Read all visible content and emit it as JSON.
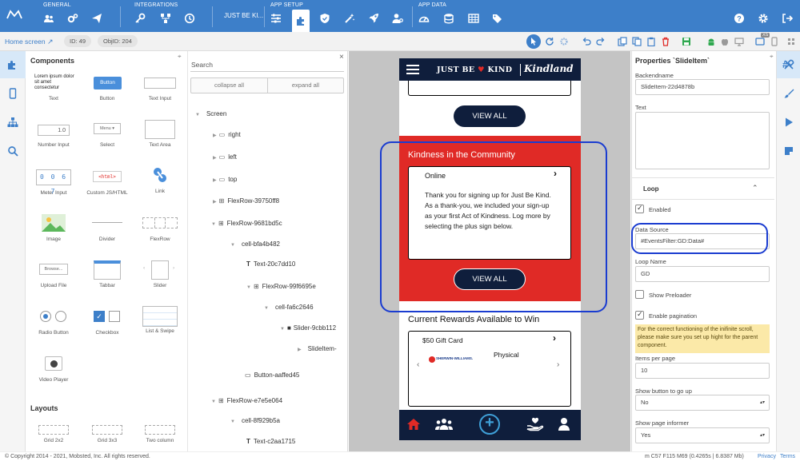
{
  "topbar": {
    "sections": {
      "general": "GENERAL",
      "integrations": "INTEGRATIONS",
      "app_setup": "APP SETUP",
      "app_data": "APP DATA"
    },
    "app_name": "JUST BE KI...",
    "colors": {
      "bar": "#3d7fc9",
      "accent": "#1a3cd0"
    }
  },
  "subbar": {
    "home_label": "Home screen",
    "id_label": "ID:",
    "id_value": "49",
    "objid_label": "ObjID:",
    "objid_value": "204",
    "badge": "XS"
  },
  "components": {
    "title": "Components",
    "items": [
      {
        "label": "Text",
        "preview": "Lorem ipsum dolor sit amet consectetur"
      },
      {
        "label": "Button",
        "preview": "Button"
      },
      {
        "label": "Text Input"
      },
      {
        "label": "Number Input",
        "preview": "1.0"
      },
      {
        "label": "Select",
        "preview": "Menu"
      },
      {
        "label": "Text Area"
      },
      {
        "label": "Meter Input",
        "preview": "0 0 6 7"
      },
      {
        "label": "Custom JS/HTML",
        "preview": "<html>"
      },
      {
        "label": "Link"
      },
      {
        "label": "Image"
      },
      {
        "label": "Divider"
      },
      {
        "label": "FlexRow"
      },
      {
        "label": "Upload File",
        "preview": "Browse..."
      },
      {
        "label": "Tabbar"
      },
      {
        "label": "Slider"
      },
      {
        "label": "Radio Button"
      },
      {
        "label": "Checkbox"
      },
      {
        "label": "List & Swipe"
      },
      {
        "label": "Video Player"
      }
    ],
    "layouts_title": "Layouts",
    "layouts": [
      {
        "label": "Grid 2x2"
      },
      {
        "label": "Grid 3x3"
      },
      {
        "label": "Two column"
      }
    ]
  },
  "tree": {
    "search_label": "Search",
    "collapse_all": "collapse all",
    "expand_all": "expand all",
    "nodes": [
      {
        "label": "Screen"
      },
      {
        "label": "right"
      },
      {
        "label": "left"
      },
      {
        "label": "top"
      },
      {
        "label": "FlexRow-39750ff8"
      },
      {
        "label": "FlexRow-9681bd5c"
      },
      {
        "label": "cell-bfa4b482"
      },
      {
        "label": "Text-20c7dd10"
      },
      {
        "label": "FlexRow-99f6695e"
      },
      {
        "label": "cell-fa6c2646"
      },
      {
        "label": "Slider-9cbb112"
      },
      {
        "label": "SlideItem-"
      },
      {
        "label": "Button-aaffed45"
      },
      {
        "label": "FlexRow-e7e5e064"
      },
      {
        "label": "cell-8f929b5a"
      },
      {
        "label": "Text-c2aa1715"
      }
    ]
  },
  "phone": {
    "brand_left": "JUST BE",
    "brand_right": "KIND",
    "brand_logo": "Kindland",
    "view_all_1": "VIEW ALL",
    "community_title": "Kindness in the Community",
    "card_title": "Online",
    "card_text": "Thank you for signing up for Just Be Kind. As a thank-you, we included your sign-up as your first Act of Kindness. Log more by selecting the plus sign below.",
    "view_all_2": "VIEW ALL",
    "rewards_title": "Current Rewards Available to Win",
    "reward_title": "$50 Gift Card",
    "reward_type": "Physical",
    "reward_brand": "SHERWIN-WILLIAMS.",
    "colors": {
      "navy": "#0f1e3c",
      "red": "#e02a26"
    }
  },
  "props": {
    "title": "Properties `SlideItem`",
    "backendname_label": "Backendname",
    "backendname_value": "SlideItem-22d4878b",
    "text_label": "Text",
    "loop_label": "Loop",
    "enabled_label": "Enabled",
    "datasource_label": "Data Source",
    "datasource_value": "#EventsFilter:GD:Data#",
    "loopname_label": "Loop Name",
    "loopname_value": "GD",
    "preloader_label": "Show Preloader",
    "pagination_label": "Enable pagination",
    "warning": "For the correct functioning of the inifinite scroll, please make sure you set up hight for the parent component.",
    "items_per_page_label": "Items per page",
    "items_per_page_value": "10",
    "show_button_label": "Show button to go up",
    "show_button_value": "No",
    "show_informer_label": "Show page informer",
    "show_informer_value": "Yes"
  },
  "footer": {
    "copyright": "© Copyright 2014 - 2021, Mobsted, Inc. All rights reserved.",
    "stats": "m C57 F115 M69 (0.4265s | 6.8387 Mb)",
    "privacy": "Privacy",
    "terms": "Terms"
  }
}
